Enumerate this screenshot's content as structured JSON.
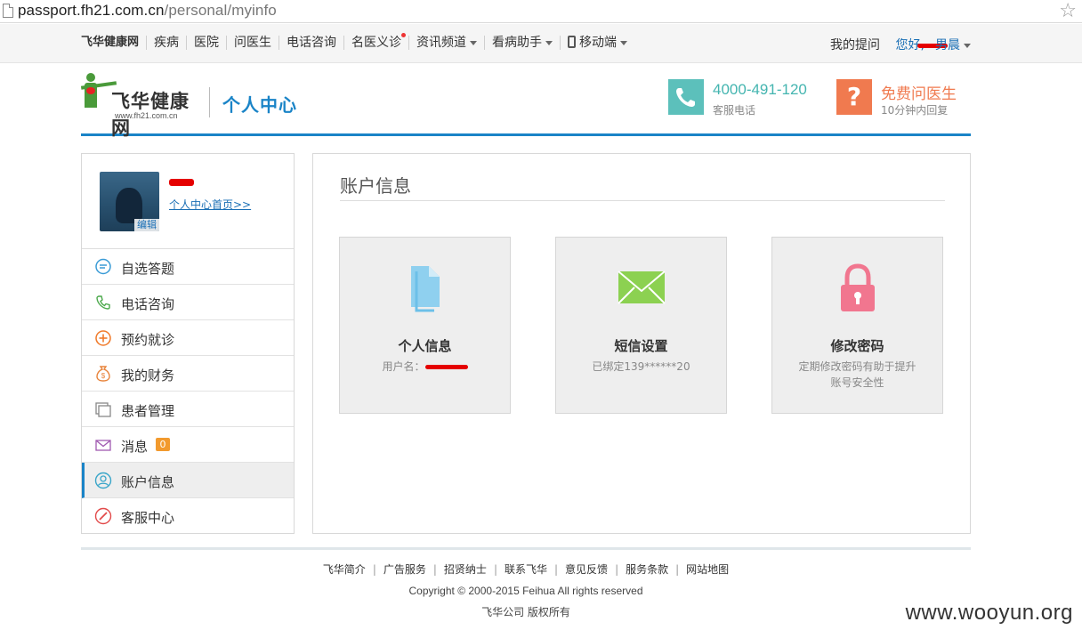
{
  "browser": {
    "url_host": "passport.fh21.com.cn",
    "url_path": "/personal/myinfo",
    "star_icon": "star-icon"
  },
  "topnav": {
    "items": [
      "飞华健康网",
      "疾病",
      "医院",
      "问医生",
      "电话咨询",
      "名医义诊",
      "资讯频道",
      "看病助手",
      "移动端"
    ],
    "my_questions": "我的提问",
    "greeting": "您好,",
    "username_suffix": "男晨"
  },
  "header": {
    "logo_name": "飞华健康网",
    "logo_domain": "www.fh21.com.cn",
    "center_title": "个人中心",
    "phone_number": "4000-491-120",
    "phone_label": "客服电话",
    "ask_doctor": "免费问医生",
    "ask_doctor_sub": "10分钟内回复"
  },
  "sidebar": {
    "avatar_edit": "编辑",
    "home_link": "个人中心首页>>",
    "menu": [
      {
        "label": "自选答题",
        "icon": "chat-bubble-icon"
      },
      {
        "label": "电话咨询",
        "icon": "phone-icon"
      },
      {
        "label": "预约就诊",
        "icon": "plus-circle-icon"
      },
      {
        "label": "我的财务",
        "icon": "money-bag-icon"
      },
      {
        "label": "患者管理",
        "icon": "windows-icon"
      },
      {
        "label": "消息",
        "icon": "envelope-icon",
        "badge": "0"
      },
      {
        "label": "账户信息",
        "icon": "user-circle-icon",
        "active": true
      },
      {
        "label": "客服中心",
        "icon": "pencil-circle-icon"
      }
    ]
  },
  "main": {
    "title": "账户信息",
    "cards": [
      {
        "name": "个人信息",
        "desc": "用户名：",
        "icon": "document-icon"
      },
      {
        "name": "短信设置",
        "desc": "已绑定139******20",
        "icon": "envelope-icon"
      },
      {
        "name": "修改密码",
        "desc": "定期修改密码有助于提升账号安全性",
        "icon": "lock-icon"
      }
    ]
  },
  "footer": {
    "links": [
      "飞华简介",
      "广告服务",
      "招贤纳士",
      "联系飞华",
      "意见反馈",
      "服务条款",
      "网站地图"
    ],
    "copyright": "Copyright © 2000-2015  Feihua All rights reserved",
    "company": "飞华公司 版权所有"
  },
  "watermark": "www.wooyun.org",
  "colors": {
    "accent_blue": "#1a84c7",
    "teal": "#5cc0bb",
    "orange": "#f07a4f",
    "redaction": "#e50000"
  }
}
